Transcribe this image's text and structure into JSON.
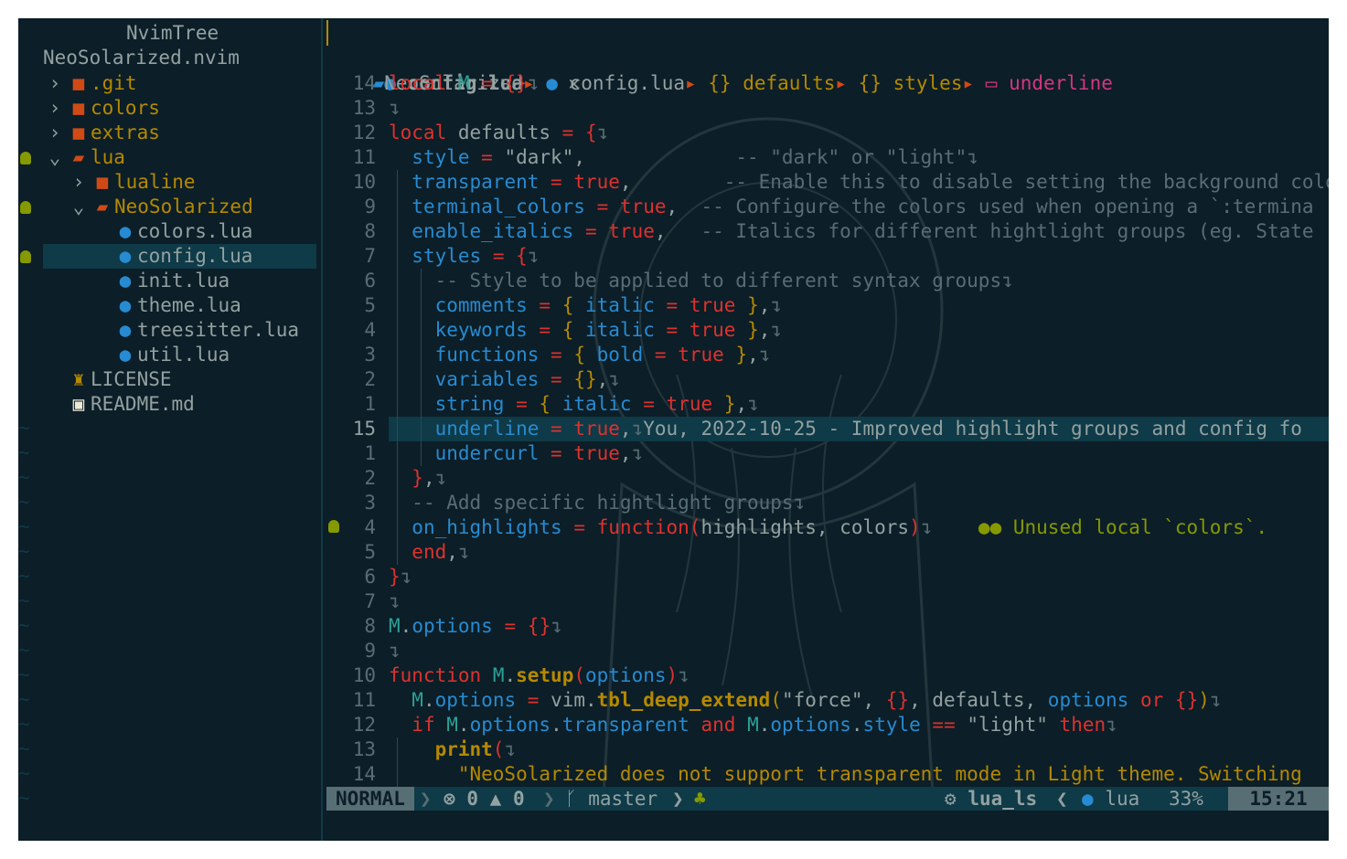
{
  "tree": {
    "header": "NvimTree",
    "root": "NeoSolarized.nvim",
    "items": [
      {
        "label": ".git",
        "arrow": ">",
        "kind": "folder",
        "indent": 0
      },
      {
        "label": "colors",
        "arrow": ">",
        "kind": "folder",
        "indent": 0
      },
      {
        "label": "extras",
        "arrow": ">",
        "kind": "folder",
        "indent": 0
      },
      {
        "label": "lua",
        "arrow": "v",
        "kind": "folder-open",
        "indent": 0,
        "bulb": true
      },
      {
        "label": "lualine",
        "arrow": ">",
        "kind": "folder",
        "indent": 1
      },
      {
        "label": "NeoSolarized",
        "arrow": "v",
        "kind": "folder-open",
        "indent": 1,
        "bulb": true
      },
      {
        "label": "colors.lua",
        "kind": "lua",
        "indent": 2
      },
      {
        "label": "config.lua",
        "kind": "lua",
        "indent": 2,
        "selected": true,
        "bulb": true
      },
      {
        "label": "init.lua",
        "kind": "lua",
        "indent": 2
      },
      {
        "label": "theme.lua",
        "kind": "lua",
        "indent": 2
      },
      {
        "label": "treesitter.lua",
        "kind": "lua",
        "indent": 2
      },
      {
        "label": "util.lua",
        "kind": "lua",
        "indent": 2
      },
      {
        "label": "LICENSE",
        "kind": "license",
        "indent": 0
      },
      {
        "label": "README.md",
        "kind": "markdown",
        "indent": 0
      }
    ]
  },
  "tab": {
    "title": "config.lua",
    "close": "✕"
  },
  "breadcrumb": {
    "folder": "NeoSolarized",
    "file": "config.lua",
    "p1": "defaults",
    "p2": "styles",
    "p3": "underline"
  },
  "line_numbers": [
    "14",
    "13",
    "12",
    "11",
    "10",
    "9",
    "8",
    "7",
    "6",
    "5",
    "4",
    "3",
    "2",
    "1",
    "15",
    "1",
    "2",
    "3",
    "4",
    "5",
    "6",
    "7",
    "8",
    "9",
    "10",
    "11",
    "12",
    "13",
    "14"
  ],
  "blame": "You, 2022-10-25 - Improved highlight groups and config fo",
  "diagnostic": "Unused local `colors`.",
  "status": {
    "mode": "NORMAL",
    "errors": "0",
    "warnings": "0",
    "branch": "master",
    "lsp": "lua_ls",
    "filetype": "lua",
    "progress": "33%",
    "position": "15:21"
  },
  "colors": {
    "background": "#0c1e27",
    "highlight": "#0f3a47",
    "keyword": "#dc322f",
    "function": "#268bd2",
    "comment": "#586e75",
    "yellow": "#b58900",
    "cyan": "#2aa198",
    "green": "#859900",
    "magenta": "#d33682"
  }
}
